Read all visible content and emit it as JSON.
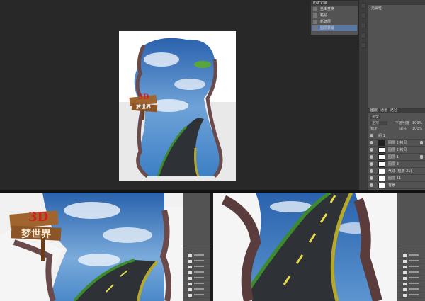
{
  "history_panel": {
    "tabs": [
      "历史记录"
    ],
    "items": [
      {
        "label": "自由变换"
      },
      {
        "label": "粘贴"
      },
      {
        "label": "新建层"
      },
      {
        "label": "图层蒙版"
      }
    ]
  },
  "properties_panel": {
    "title": "无属性"
  },
  "layers_panel": {
    "tabs": [
      "图层",
      "通道",
      "路径"
    ],
    "kind_label": "类型",
    "blend_mode": "正常",
    "opacity_label": "不透明度",
    "opacity_value": "100%",
    "lock_label": "锁定",
    "fill_label": "填充",
    "fill_value": "100%",
    "group_name": "组 1",
    "layers": [
      {
        "name": "图层 2 拷贝",
        "locked": true
      },
      {
        "name": "图层 2 拷贝",
        "locked": false
      },
      {
        "name": "图层 1",
        "locked": true
      },
      {
        "name": "图层 3",
        "locked": false
      },
      {
        "name": "气球 (框架 21)",
        "locked": false
      },
      {
        "name": "图层 11",
        "locked": false
      },
      {
        "name": "背景",
        "locked": false
      }
    ]
  },
  "poster": {
    "sign_line1": "3D",
    "sign_line2": "梦世界"
  },
  "colors": {
    "workspace": "#282828",
    "panel": "#535353",
    "selection": "#5a77a3",
    "sky": "#2f6fb8",
    "road": "#2e3236",
    "road_edge": "#b6a82a",
    "sign_wood": "#a0652f",
    "sign_text": "#d42020"
  }
}
